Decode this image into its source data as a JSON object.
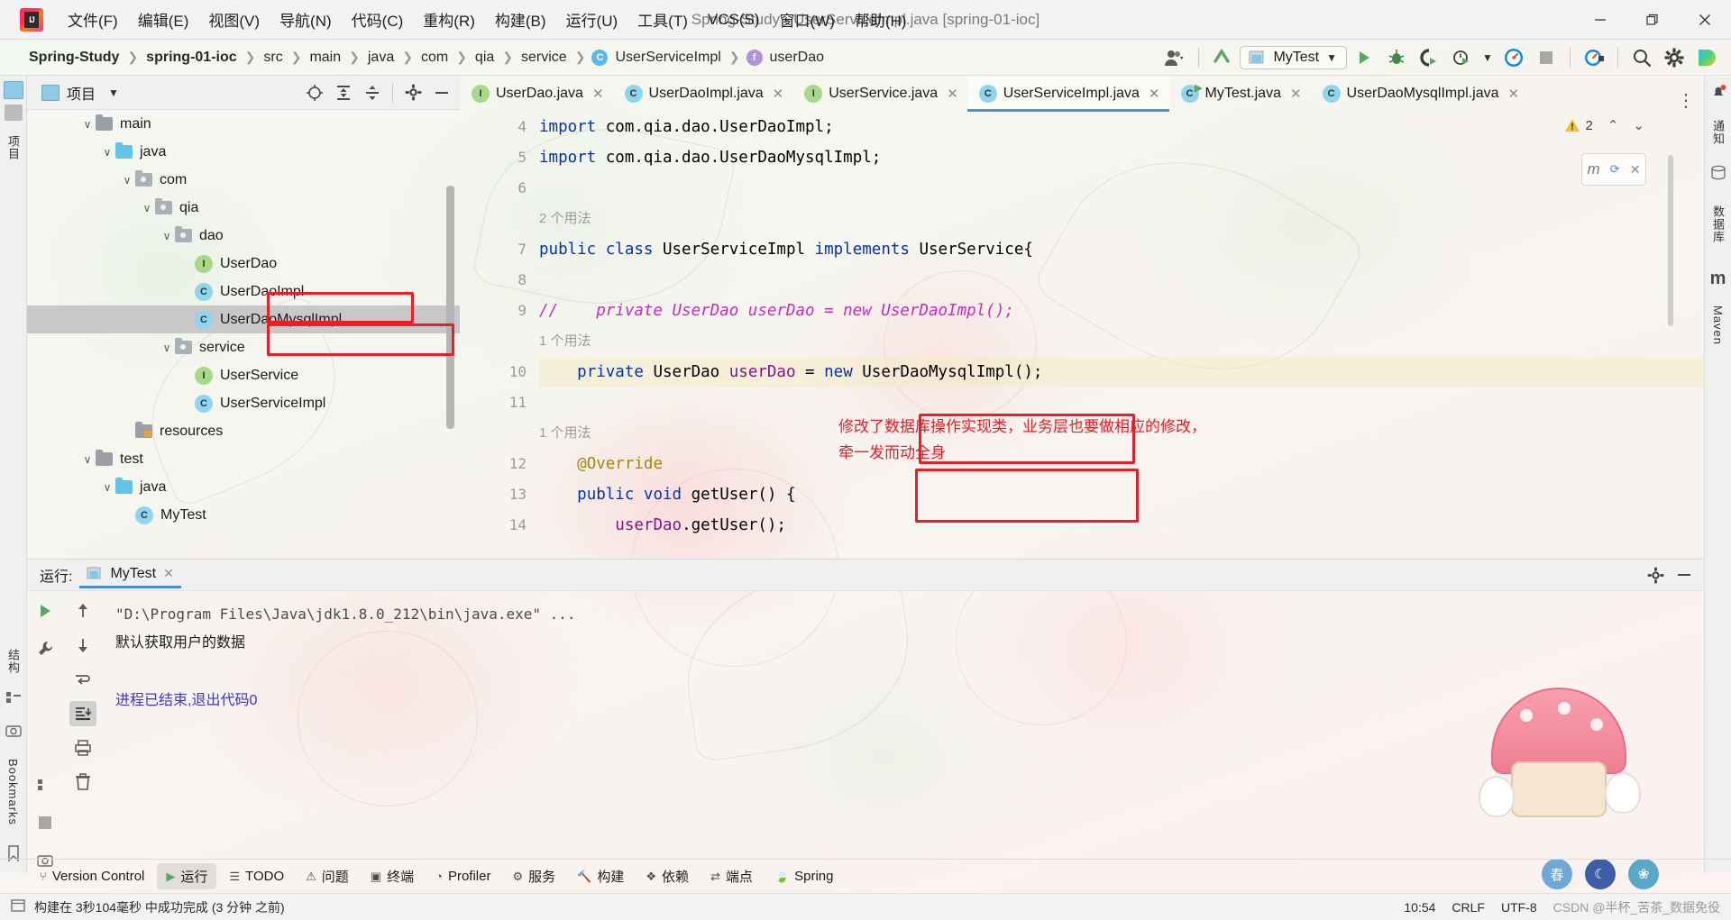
{
  "window": {
    "title": "Spring-Study - UserServiceImpl.java [spring-01-ioc]",
    "minimize": "–",
    "maximize": "❐",
    "close": "✕"
  },
  "menubar": {
    "items": [
      {
        "label": "文件(F)"
      },
      {
        "label": "编辑(E)"
      },
      {
        "label": "视图(V)"
      },
      {
        "label": "导航(N)"
      },
      {
        "label": "代码(C)"
      },
      {
        "label": "重构(R)"
      },
      {
        "label": "构建(B)"
      },
      {
        "label": "运行(U)"
      },
      {
        "label": "工具(T)"
      },
      {
        "label": "VCS(S)"
      },
      {
        "label": "窗口(W)"
      },
      {
        "label": "帮助(H)"
      }
    ]
  },
  "breadcrumb": {
    "items": [
      {
        "label": "Spring-Study",
        "bold": true,
        "icon": ""
      },
      {
        "label": "spring-01-ioc",
        "bold": true,
        "icon": ""
      },
      {
        "label": "src",
        "bold": false,
        "icon": ""
      },
      {
        "label": "main",
        "bold": false,
        "icon": ""
      },
      {
        "label": "java",
        "bold": false,
        "icon": ""
      },
      {
        "label": "com",
        "bold": false,
        "icon": ""
      },
      {
        "label": "qia",
        "bold": false,
        "icon": ""
      },
      {
        "label": "service",
        "bold": false,
        "icon": ""
      },
      {
        "label": "UserServiceImpl",
        "bold": false,
        "icon": "C"
      },
      {
        "label": "userDao",
        "bold": false,
        "icon": "f"
      }
    ],
    "separator": "❯"
  },
  "toolbar": {
    "run_config": "MyTest",
    "icons": [
      "user-avatar-icon",
      "update-project-icon",
      "run-icon",
      "debug-icon",
      "run-with-coverage-icon",
      "profiler-icon",
      "stop-icon",
      "plug-icon",
      "search-everywhere-icon",
      "settings-icon",
      "idea-assistant-icon"
    ]
  },
  "left_strip": {
    "items": [
      {
        "label": "项目",
        "name": "tool-window-project"
      },
      {
        "label": "结构",
        "name": "tool-window-structure"
      },
      {
        "label": "Bookmarks",
        "name": "tool-window-bookmarks"
      }
    ]
  },
  "right_strip": {
    "items": [
      {
        "label": "通知",
        "name": "tool-window-notifications"
      },
      {
        "label": "数据库",
        "name": "tool-window-database"
      },
      {
        "label": "Maven",
        "name": "tool-window-maven"
      }
    ]
  },
  "project_panel": {
    "title": "项目",
    "tree": [
      {
        "indent": 2,
        "chevron": "∨",
        "kind": "folder-gray",
        "label": "main",
        "selected": false,
        "boxed": false
      },
      {
        "indent": 3,
        "chevron": "∨",
        "kind": "folder-blue",
        "label": "java",
        "selected": false,
        "boxed": false
      },
      {
        "indent": 4,
        "chevron": "∨",
        "kind": "folder-pkg",
        "label": "com",
        "selected": false,
        "boxed": false
      },
      {
        "indent": 5,
        "chevron": "∨",
        "kind": "folder-pkg",
        "label": "qia",
        "selected": false,
        "boxed": false
      },
      {
        "indent": 6,
        "chevron": "∨",
        "kind": "folder-pkg",
        "label": "dao",
        "selected": false,
        "boxed": false
      },
      {
        "indent": 7,
        "chevron": "",
        "kind": "iface",
        "label": "UserDao",
        "selected": false,
        "boxed": false
      },
      {
        "indent": 7,
        "chevron": "",
        "kind": "class",
        "label": "UserDaoImpl",
        "selected": false,
        "boxed": true
      },
      {
        "indent": 7,
        "chevron": "",
        "kind": "class",
        "label": "UserDaoMysqlImpl",
        "selected": true,
        "boxed": true
      },
      {
        "indent": 6,
        "chevron": "∨",
        "kind": "folder-pkg",
        "label": "service",
        "selected": false,
        "boxed": false
      },
      {
        "indent": 7,
        "chevron": "",
        "kind": "iface",
        "label": "UserService",
        "selected": false,
        "boxed": false
      },
      {
        "indent": 7,
        "chevron": "",
        "kind": "class",
        "label": "UserServiceImpl",
        "selected": false,
        "boxed": false
      },
      {
        "indent": 4,
        "chevron": "",
        "kind": "folder-res",
        "label": "resources",
        "selected": false,
        "boxed": false
      },
      {
        "indent": 2,
        "chevron": "∨",
        "kind": "folder-gray",
        "label": "test",
        "selected": false,
        "boxed": false
      },
      {
        "indent": 3,
        "chevron": "∨",
        "kind": "folder-blue",
        "label": "java",
        "selected": false,
        "boxed": false
      },
      {
        "indent": 4,
        "chevron": "",
        "kind": "class",
        "label": "MyTest",
        "selected": false,
        "boxed": false
      }
    ]
  },
  "editor": {
    "tabs": [
      {
        "label": "UserDao.java",
        "icon": "I",
        "active": false,
        "running": false
      },
      {
        "label": "UserDaoImpl.java",
        "icon": "C",
        "active": false,
        "running": false
      },
      {
        "label": "UserService.java",
        "icon": "I",
        "active": false,
        "running": false
      },
      {
        "label": "UserServiceImpl.java",
        "icon": "C",
        "active": true,
        "running": false
      },
      {
        "label": "MyTest.java",
        "icon": "C",
        "active": false,
        "running": true
      },
      {
        "label": "UserDaoMysqlImpl.java",
        "icon": "C",
        "active": false,
        "running": false
      }
    ],
    "close_glyph": "✕",
    "overflow_glyph": "⋮",
    "warning_count": "2",
    "lines": [
      {
        "num": "4",
        "kind": "code",
        "text": "import com.qia.dao.UserDaoImpl;"
      },
      {
        "num": "5",
        "kind": "code",
        "text": "import com.qia.dao.UserDaoMysqlImpl;"
      },
      {
        "num": "6",
        "kind": "code",
        "text": ""
      },
      {
        "num": "",
        "kind": "hint",
        "text": "2 个用法"
      },
      {
        "num": "7",
        "kind": "code",
        "text": "public class UserServiceImpl implements UserService{"
      },
      {
        "num": "8",
        "kind": "code",
        "text": ""
      },
      {
        "num": "9",
        "kind": "code",
        "text": "//    private UserDao userDao = new UserDaoImpl();"
      },
      {
        "num": "",
        "kind": "hint",
        "text": "1 个用法"
      },
      {
        "num": "10",
        "kind": "code",
        "text": "    private UserDao userDao = new UserDaoMysqlImpl();"
      },
      {
        "num": "11",
        "kind": "code",
        "text": ""
      },
      {
        "num": "",
        "kind": "hint",
        "text": "1 个用法"
      },
      {
        "num": "12",
        "kind": "code",
        "text": "    @Override"
      },
      {
        "num": "13",
        "kind": "code",
        "text": "    public void getUser() {"
      },
      {
        "num": "14",
        "kind": "code",
        "text": "        userDao.getUser();"
      }
    ],
    "annotation": "修改了数据库操作实现类，业务层也要做相应的修改，\n牵一发而动全身"
  },
  "run_panel": {
    "label": "运行:",
    "tab": "MyTest",
    "close_glyph": "✕",
    "console": [
      {
        "text": "\"D:\\Program Files\\Java\\jdk1.8.0_212\\bin\\java.exe\" ...",
        "style": "cmd"
      },
      {
        "text": "默认获取用户的数据",
        "style": "cn"
      },
      {
        "text": "",
        "style": "cmd"
      },
      {
        "text": "进程已结束,退出代码0",
        "style": "exit"
      }
    ]
  },
  "bottom_bar": {
    "items": [
      {
        "label": "Version Control",
        "icon": "branch-icon",
        "active": false
      },
      {
        "label": "运行",
        "icon": "run-icon",
        "active": true
      },
      {
        "label": "TODO",
        "icon": "todo-icon",
        "active": false
      },
      {
        "label": "问题",
        "icon": "problems-icon",
        "active": false
      },
      {
        "label": "终端",
        "icon": "terminal-icon",
        "active": false
      },
      {
        "label": "Profiler",
        "icon": "profiler-icon",
        "active": false
      },
      {
        "label": "服务",
        "icon": "services-icon",
        "active": false
      },
      {
        "label": "构建",
        "icon": "build-icon",
        "active": false
      },
      {
        "label": "依赖",
        "icon": "dependency-icon",
        "active": false
      },
      {
        "label": "端点",
        "icon": "endpoints-icon",
        "active": false
      },
      {
        "label": "Spring",
        "icon": "spring-icon",
        "active": false
      }
    ]
  },
  "status_bar": {
    "message": "构建在 3秒104毫秒 中成功完成 (3 分钟 之前)",
    "time": "10:54",
    "line_sep": "CRLF",
    "encoding": "UTF-8",
    "watermark": "CSDN @半杯_苦茶_数据免役"
  },
  "colors": {
    "accent": "#4a90d9",
    "annotation_red": "#ee1c24",
    "keyword_blue": "#0033b3",
    "field_purple": "#871094",
    "comment_gray": "#8c8c8c",
    "comment_magenta": "#cc2bc0",
    "annotation_yellow": "#9e880d",
    "exit_blue": "#3a35d6",
    "run_green": "#59a869"
  }
}
